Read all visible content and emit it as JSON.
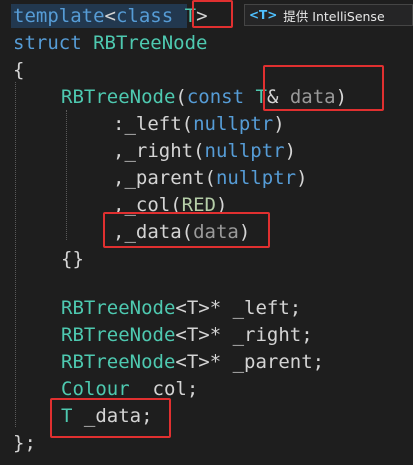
{
  "hover_tooltip": {
    "badge": "<T>",
    "text": "提供 IntelliSense"
  },
  "code": {
    "l1_kw": "template",
    "l1_lt": "<",
    "l1_class": "class",
    "l1_sp": " ",
    "l1_T": "T",
    "l1_gt": ">",
    "l2_kw": "struct",
    "l2_name": "RBTreeNode",
    "l3": "{",
    "l4_name": "RBTreeNode",
    "l4_open": "(",
    "l4_const": "const",
    "l4_T": "T",
    "l4_amp": "&",
    "l4_param": "data",
    "l4_close": ")",
    "l5_colon": ":",
    "l5_member": "_left",
    "l5_open": "(",
    "l5_val": "nullptr",
    "l5_close": ")",
    "l6_comma": ",",
    "l6_member": "_right",
    "l6_val": "nullptr",
    "l7_member": "_parent",
    "l7_val": "nullptr",
    "l8_member": "_col",
    "l8_val": "RED",
    "l9_member": "_data",
    "l9_val": "data",
    "l10": "{}",
    "l12_type": "RBTreeNode",
    "l12_targ": "<T>*",
    "l12_member": "_left;",
    "l13_type": "RBTreeNode",
    "l13_targ": "<T>*",
    "l13_member": "_right;",
    "l14_type": "RBTreeNode",
    "l14_targ": "<T>*",
    "l14_member": "_parent;",
    "l15_type": "Colour",
    "l15_member": "_col;",
    "l16_type": "T",
    "l16_member": "_data;",
    "l17": "};"
  }
}
